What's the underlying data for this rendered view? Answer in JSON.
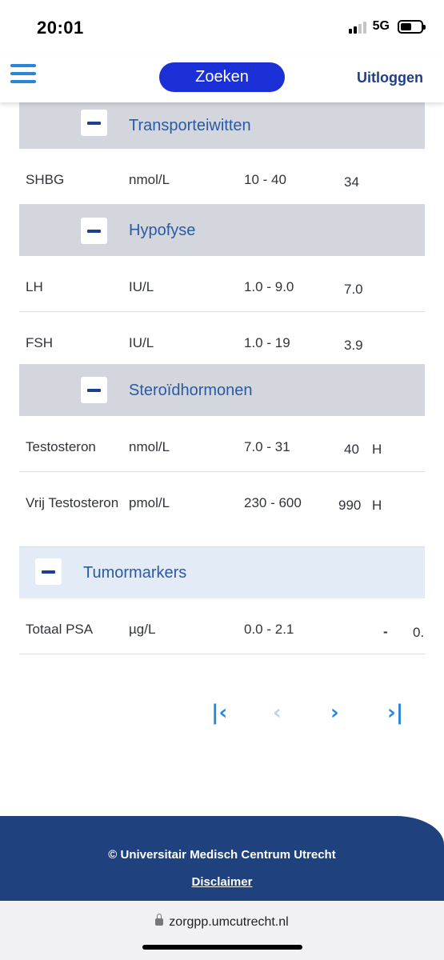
{
  "status_bar": {
    "time": "20:01",
    "network": "5G"
  },
  "header": {
    "search_label": "Zoeken",
    "logout_label": "Uitloggen"
  },
  "groups": [
    {
      "title": "Transporteiwitten",
      "rows": [
        {
          "name": "SHBG",
          "unit": "nmol/L",
          "range": "10 - 40",
          "value": "34",
          "flag": ""
        }
      ]
    },
    {
      "title": "Hypofyse",
      "rows": [
        {
          "name": "LH",
          "unit": "IU/L",
          "range": "1.0 - 9.0",
          "value": "7.0",
          "flag": ""
        },
        {
          "name": "FSH",
          "unit": "IU/L",
          "range": "1.0 - 19",
          "value": "3.9",
          "flag": ""
        }
      ]
    },
    {
      "title": "Steroïdhormonen",
      "rows": [
        {
          "name": "Testosteron",
          "unit": "nmol/L",
          "range": "7.0 - 31",
          "value": "40",
          "flag": "H"
        },
        {
          "name": "Vrij Testosteron",
          "unit": "pmol/L",
          "range": "230 - 600",
          "value": "990",
          "flag": "H"
        }
      ]
    },
    {
      "title": "Tumormarkers",
      "rows": [
        {
          "name": "Totaal PSA",
          "unit": "µg/L",
          "range": "0.0 - 2.1",
          "value": "-",
          "flag": "0."
        }
      ]
    }
  ],
  "pagination": {
    "first": "first-page",
    "prev": "previous-page",
    "next": "next-page",
    "last": "last-page"
  },
  "footer": {
    "copyright": "© Universitair Medisch Centrum Utrecht",
    "disclaimer": "Disclaimer"
  },
  "browser": {
    "url": "zorgpp.umcutrecht.nl"
  },
  "colors": {
    "accent": "#1a2fd6",
    "link": "#1f3f8a",
    "group_bg": "#d3d7dd",
    "footer_bg": "#1f427f"
  }
}
